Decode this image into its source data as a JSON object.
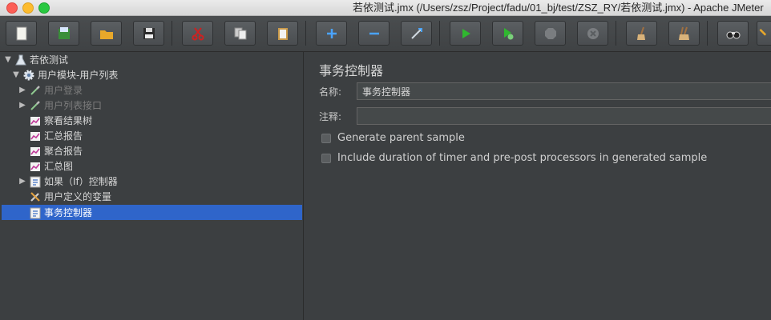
{
  "window": {
    "title": "若依测试.jmx (/Users/zsz/Project/fadu/01_bj/test/ZSZ_RY/若依测试.jmx) - Apache JMeter"
  },
  "toolbar": {
    "buttons": [
      "new",
      "templates",
      "open",
      "save",
      "cut",
      "copy",
      "paste",
      "expand",
      "collapse",
      "toggle",
      "start",
      "start-no-pauses",
      "stop",
      "shutdown",
      "clear",
      "clear-all",
      "search",
      "reset-search"
    ]
  },
  "tree": {
    "root": "若依测试",
    "thread_group": "用户模块-用户列表",
    "items": [
      {
        "label": "用户登录",
        "icon": "sampler-pipette-icon",
        "disabled": true
      },
      {
        "label": "用户列表接口",
        "icon": "sampler-pipette-icon",
        "disabled": true
      },
      {
        "label": "察看结果树",
        "icon": "listener-chart-icon",
        "disabled": false
      },
      {
        "label": "汇总报告",
        "icon": "listener-chart-icon",
        "disabled": false
      },
      {
        "label": "聚合报告",
        "icon": "listener-chart-icon",
        "disabled": false
      },
      {
        "label": "汇总图",
        "icon": "listener-chart-icon",
        "disabled": false
      },
      {
        "label": "如果（If）控制器",
        "icon": "controller-icon",
        "disabled": false
      },
      {
        "label": "用户定义的变量",
        "icon": "tools-icon",
        "disabled": false
      },
      {
        "label": "事务控制器",
        "icon": "controller-icon",
        "disabled": false,
        "selected": true
      }
    ]
  },
  "panel": {
    "title": "事务控制器",
    "name_label": "名称:",
    "name_value": "事务控制器",
    "comment_label": "注释:",
    "comment_value": "",
    "checkboxes": [
      {
        "label": "Generate parent sample",
        "checked": false
      },
      {
        "label": "Include duration of timer and pre-post processors in generated sample",
        "checked": false
      }
    ]
  },
  "colors": {
    "selection": "#2f65ca",
    "background": "#3c3f41",
    "green": "#2fb82f"
  }
}
